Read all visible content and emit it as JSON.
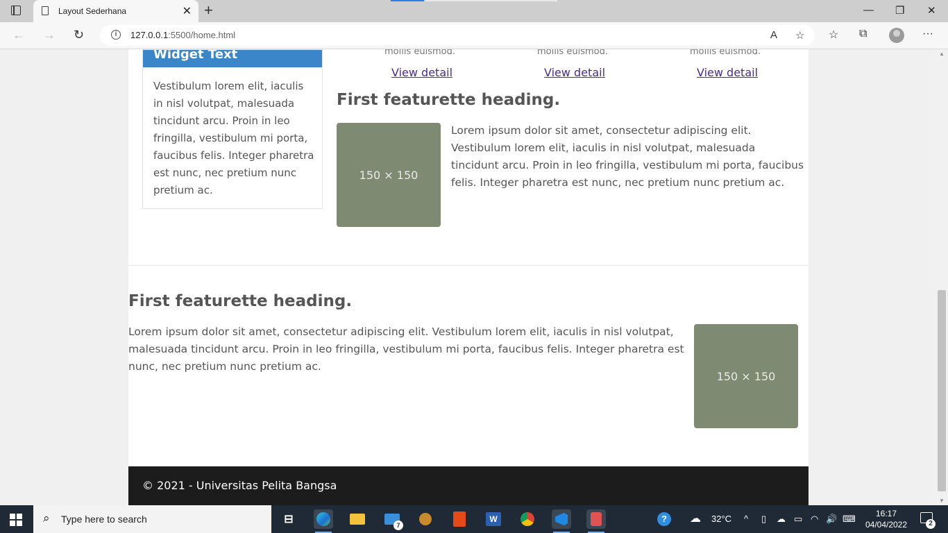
{
  "browser": {
    "tab_title": "Layout Sederhana",
    "tab_close": "✕",
    "new_tab": "+",
    "url_host": "127.0.0.1",
    "url_rest": ":5500/home.html",
    "window": {
      "minimize": "—",
      "restore": "❐",
      "close": "✕"
    },
    "nav": {
      "back": "←",
      "forward": "→",
      "refresh": "↻"
    },
    "url_icons": {
      "read_aloud": "A",
      "favorite": "☆"
    },
    "toolbar_icons": {
      "favorites": "☆",
      "collections": "⧉",
      "more": "···"
    }
  },
  "widget": {
    "title": "Widget Text",
    "body": "Vestibulum lorem elit, iaculis in nisl volutpat, malesuada tincidunt arcu. Proin in leo fringilla, vestibulum mi porta, faucibus felis. Integer pharetra est nunc, nec pretium nunc pretium ac."
  },
  "cards": [
    {
      "cut_text": "mollis euismod.",
      "link": "View detail"
    },
    {
      "cut_text": "mollis euismod.",
      "link": "View detail"
    },
    {
      "cut_text": "mollis euismod.",
      "link": "View detail"
    }
  ],
  "featurette1": {
    "heading": "First featurette heading.",
    "image_label": "150 × 150",
    "text": "Lorem ipsum dolor sit amet, consectetur adipiscing elit. Vestibulum lorem elit, iaculis in nisl volutpat, malesuada tincidunt arcu. Proin in leo fringilla, vestibulum mi porta, faucibus felis. Integer pharetra est nunc, nec pretium nunc pretium ac."
  },
  "featurette2": {
    "heading": "First featurette heading.",
    "image_label": "150 × 150",
    "text": "Lorem ipsum dolor sit amet, consectetur adipiscing elit. Vestibulum lorem elit, iaculis in nisl volutpat, malesuada tincidunt arcu. Proin in leo fringilla, vestibulum mi porta, faucibus felis. Integer pharetra est nunc, nec pretium nunc pretium ac."
  },
  "footer": {
    "text": "© 2021 - Universitas Pelita Bangsa"
  },
  "taskbar": {
    "search_placeholder": "Type here to search",
    "search_icon": "⌕",
    "mail_badge": "7",
    "weather": "32°C",
    "time": "16:17",
    "date": "04/04/2022",
    "notification_count": "2",
    "help_glyph": "?",
    "tray_glyphs": {
      "chevron": "^",
      "speaker": "🔊"
    }
  },
  "colors": {
    "widget_header": "#3a86c8",
    "placeholder": "#7f8a72",
    "footer_bg": "#1c1c1c",
    "link": "#4b2c86",
    "taskbar": "#1f2a36"
  }
}
